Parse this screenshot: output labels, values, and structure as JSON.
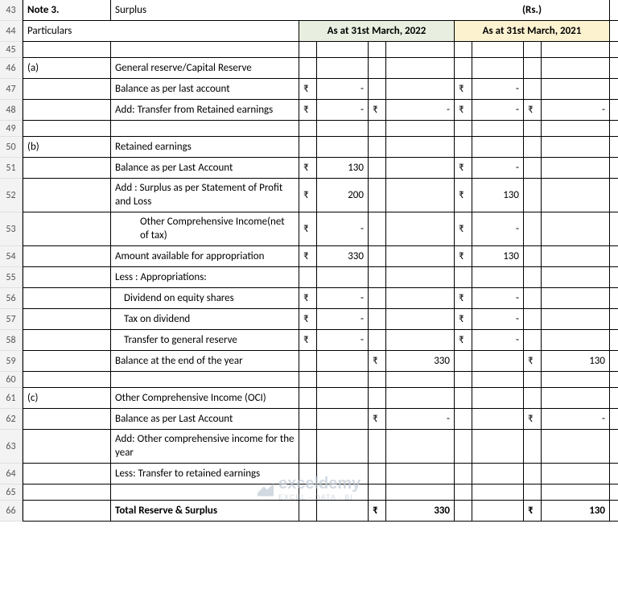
{
  "rows": [
    43,
    44,
    45,
    46,
    47,
    48,
    49,
    50,
    51,
    52,
    53,
    54,
    55,
    56,
    57,
    58,
    59,
    60,
    61,
    62,
    63,
    64,
    65,
    66
  ],
  "heights": {
    "43": 26,
    "44": 26,
    "45": 20,
    "46": 26,
    "47": 26,
    "48": 26,
    "49": 20,
    "50": 26,
    "51": 26,
    "52": 42,
    "53": 42,
    "54": 26,
    "55": 26,
    "56": 26,
    "57": 26,
    "58": 26,
    "59": 26,
    "60": 20,
    "61": 26,
    "62": 26,
    "63": 42,
    "64": 26,
    "65": 20,
    "66": 26
  },
  "header": {
    "note_label": "Note 3.",
    "title": "Surplus",
    "currency": "(Rs.)",
    "particulars": "Particulars",
    "col2022": "As at 31st March, 2022",
    "col2021": "As at 31st March, 2021"
  },
  "rupee": "₹",
  "dash": "-",
  "rows_data": {
    "46": {
      "a": "(a)",
      "b": "General reserve/Capital Reserve"
    },
    "47": {
      "b": "Balance as per last account",
      "c": "₹",
      "d": "-",
      "g": "₹",
      "h": "-"
    },
    "48": {
      "b": "Add: Transfer from Retained earnings",
      "c": "₹",
      "d": "-",
      "e": "₹",
      "f": "-",
      "g": "₹",
      "h": "-",
      "i": "₹",
      "j": "-"
    },
    "50": {
      "a": "(b)",
      "b": "Retained earnings"
    },
    "51": {
      "b": "Balance as per Last Account",
      "c": "₹",
      "d": "130",
      "g": "₹",
      "h": "-"
    },
    "52": {
      "b": "Add : Surplus as per Statement of Profit and Loss",
      "c": "₹",
      "d": "200",
      "g": "₹",
      "h": "130"
    },
    "53": {
      "b": "Other Comprehensive Income(net of tax)",
      "c": "₹",
      "d": "-",
      "g": "₹",
      "h": "-"
    },
    "54": {
      "b": "Amount available for appropriation",
      "c": "₹",
      "d": "330",
      "g": "₹",
      "h": "130"
    },
    "55": {
      "b": "Less : Appropriations:"
    },
    "56": {
      "b": "Dividend on equity shares",
      "c": "₹",
      "d": "-",
      "g": "₹",
      "h": "-"
    },
    "57": {
      "b": "Tax on dividend",
      "c": "₹",
      "d": "-",
      "g": "₹",
      "h": "-"
    },
    "58": {
      "b": "Transfer to general reserve",
      "c": "₹",
      "d": "-",
      "g": "₹",
      "h": "-"
    },
    "59": {
      "b": "Balance at the end of the year",
      "e": "₹",
      "f": "330",
      "i": "₹",
      "j": "130"
    },
    "61": {
      "a": "(c)",
      "b": "Other Comprehensive Income (OCI)"
    },
    "62": {
      "b": "Balance as per Last Account",
      "e": "₹",
      "f": "-",
      "i": "₹",
      "j": "-"
    },
    "63": {
      "b": "Add: Other comprehensive income for the year"
    },
    "64": {
      "b": "Less: Transfer to retained earnings"
    },
    "66": {
      "b": "Total Reserve & Surplus",
      "e": "₹",
      "f": "330",
      "i": "₹",
      "j": "130"
    }
  },
  "watermark": {
    "brand": "exceldemy",
    "tagline": "EXCEL · DATA · BI"
  },
  "chart_data": {
    "type": "table",
    "title": "Note 3. Surplus (Rs.)",
    "columns": [
      "Particulars",
      "As at 31st March, 2022 (sub)",
      "As at 31st March, 2022 (total)",
      "As at 31st March, 2021 (sub)",
      "As at 31st March, 2021 (total)"
    ],
    "sections": [
      {
        "id": "(a)",
        "name": "General reserve/Capital Reserve",
        "lines": [
          {
            "label": "Balance as per last account",
            "v22": 0,
            "v21": 0
          },
          {
            "label": "Add: Transfer from Retained earnings",
            "v22": 0,
            "t22": 0,
            "v21": 0,
            "t21": 0
          }
        ]
      },
      {
        "id": "(b)",
        "name": "Retained earnings",
        "lines": [
          {
            "label": "Balance as per Last Account",
            "v22": 130,
            "v21": 0
          },
          {
            "label": "Add: Surplus as per Statement of Profit and Loss",
            "v22": 200,
            "v21": 130
          },
          {
            "label": "Other Comprehensive Income (net of tax)",
            "v22": 0,
            "v21": 0
          },
          {
            "label": "Amount available for appropriation",
            "v22": 330,
            "v21": 130
          },
          {
            "label": "Less: Appropriations:"
          },
          {
            "label": "Dividend on equity shares",
            "v22": 0,
            "v21": 0
          },
          {
            "label": "Tax on dividend",
            "v22": 0,
            "v21": 0
          },
          {
            "label": "Transfer to general reserve",
            "v22": 0,
            "v21": 0
          },
          {
            "label": "Balance at the end of the year",
            "t22": 330,
            "t21": 130
          }
        ]
      },
      {
        "id": "(c)",
        "name": "Other Comprehensive Income (OCI)",
        "lines": [
          {
            "label": "Balance as per Last Account",
            "t22": 0,
            "t21": 0
          },
          {
            "label": "Add: Other comprehensive income for the year"
          },
          {
            "label": "Less: Transfer to retained earnings"
          }
        ]
      },
      {
        "id": "total",
        "name": "Total Reserve & Surplus",
        "t22": 330,
        "t21": 130
      }
    ]
  }
}
